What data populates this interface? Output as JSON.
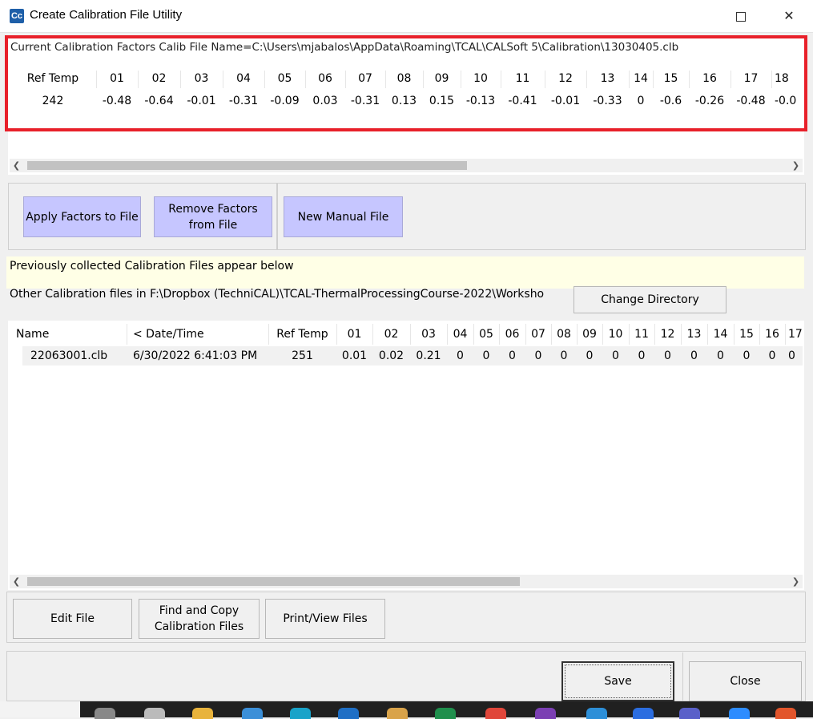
{
  "window": {
    "title": "Create Calibration File Utility",
    "icon_text": "Cc",
    "maximize_glyph": "",
    "close_glyph": "✕"
  },
  "current": {
    "label": "Current Calibration Factors Calib File Name=C:\\Users\\mjabalos\\AppData\\Roaming\\TCAL\\CALSoft 5\\Calibration\\13030405.clb",
    "headers": [
      "Ref Temp",
      "01",
      "02",
      "03",
      "04",
      "05",
      "06",
      "07",
      "08",
      "09",
      "10",
      "11",
      "12",
      "13",
      "14",
      "15",
      "16",
      "17",
      "18"
    ],
    "values": [
      "242",
      "-0.48",
      "-0.64",
      "-0.01",
      "-0.31",
      "-0.09",
      "0.03",
      "-0.31",
      "0.13",
      "0.15",
      "-0.13",
      "-0.41",
      "-0.01",
      "-0.33",
      "0",
      "-0.6",
      "-0.26",
      "-0.48",
      "-0.0"
    ],
    "scroll_fraction": 0.58
  },
  "buttons": {
    "apply_factors": "Apply Factors to File",
    "remove_factors": "Remove Factors from File",
    "new_manual": "New Manual File",
    "change_directory": "Change Directory",
    "edit_file": "Edit File",
    "find_copy": "Find and Copy Calibration Files",
    "print_view": "Print/View Files",
    "save": "Save",
    "close": "Close"
  },
  "info": {
    "previously_collected": "Previously collected Calibration Files appear below",
    "other_files": "Other Calibration files in F:\\Dropbox (TechniCAL)\\TCAL-ThermalProcessingCourse-2022\\Worksho"
  },
  "files_table": {
    "headers": [
      "Name",
      "< Date/Time",
      "Ref Temp",
      "01",
      "02",
      "03",
      "04",
      "05",
      "06",
      "07",
      "08",
      "09",
      "10",
      "11",
      "12",
      "13",
      "14",
      "15",
      "16",
      "17"
    ],
    "rows": [
      [
        "22063001.clb",
        "6/30/2022 6:41:03 PM",
        "251",
        "0.01",
        "0.02",
        "0.21",
        "0",
        "0",
        "0",
        "0",
        "0",
        "0",
        "0",
        "0",
        "0",
        "0",
        "0",
        "0",
        "0",
        "0"
      ]
    ],
    "scroll_fraction": 0.65
  },
  "colors": {
    "highlight_box": "#e8202a",
    "button_blue": "#c6c6ff",
    "info_strip": "#ffffe6"
  },
  "taskbar": {
    "icons": [
      "file-explorer-icon",
      "search-icon",
      "folder-icon",
      "edge-icon",
      "browser-icon",
      "outlook-icon",
      "paint-icon",
      "excel-icon",
      "chrome-icon",
      "onenote-icon",
      "vscode-icon",
      "app-icon",
      "teams-icon",
      "zoom-icon",
      "office-icon"
    ]
  }
}
